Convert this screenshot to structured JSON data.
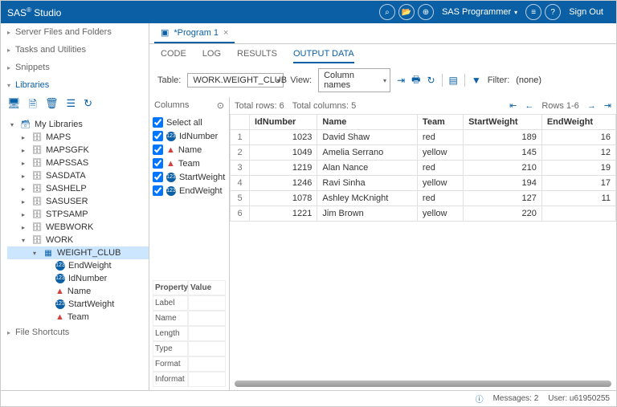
{
  "header": {
    "title_prefix": "SAS",
    "title_suffix": " Studio",
    "role": "SAS Programmer",
    "signout": "Sign Out"
  },
  "sidebar": {
    "sections": {
      "server_files": "Server Files and Folders",
      "tasks": "Tasks and Utilities",
      "snippets": "Snippets",
      "libraries": "Libraries",
      "shortcuts": "File Shortcuts"
    },
    "my_libraries": "My Libraries",
    "libs": [
      "MAPS",
      "MAPSGFK",
      "MAPSSAS",
      "SASDATA",
      "SASHELP",
      "SASUSER",
      "STPSAMP",
      "WEBWORK",
      "WORK"
    ],
    "table": "WEIGHT_CLUB",
    "table_cols": [
      {
        "name": "EndWeight",
        "type": "num"
      },
      {
        "name": "IdNumber",
        "type": "num"
      },
      {
        "name": "Name",
        "type": "char"
      },
      {
        "name": "StartWeight",
        "type": "num"
      },
      {
        "name": "Team",
        "type": "char"
      }
    ]
  },
  "tabs": {
    "program": "*Program 1",
    "sub": {
      "code": "CODE",
      "log": "LOG",
      "results": "RESULTS",
      "output": "OUTPUT DATA"
    }
  },
  "toolbar": {
    "table_label": "Table:",
    "table_value": "WORK.WEIGHT_CLUB",
    "view_label": "View:",
    "view_value": "Column names",
    "filter_label": "Filter:",
    "filter_value": "(none)"
  },
  "columns_panel": {
    "heading": "Columns",
    "select_all": "Select all",
    "cols": [
      {
        "name": "IdNumber",
        "type": "num"
      },
      {
        "name": "Name",
        "type": "char"
      },
      {
        "name": "Team",
        "type": "char"
      },
      {
        "name": "StartWeight",
        "type": "num"
      },
      {
        "name": "EndWeight",
        "type": "num"
      }
    ],
    "props": {
      "heading_k": "Property",
      "heading_v": "Value",
      "rows": [
        "Label",
        "Name",
        "Length",
        "Type",
        "Format",
        "Informat"
      ]
    }
  },
  "data": {
    "total_rows_label": "Total rows: 6",
    "total_cols_label": "Total columns: 5",
    "rows_range": "Rows 1-6",
    "headers": [
      "IdNumber",
      "Name",
      "Team",
      "StartWeight",
      "EndWeight"
    ],
    "rows": [
      {
        "n": "1",
        "IdNumber": "1023",
        "Name": "David Shaw",
        "Team": "red",
        "StartWeight": "189",
        "EndWeight": "16"
      },
      {
        "n": "2",
        "IdNumber": "1049",
        "Name": "Amelia Serrano",
        "Team": "yellow",
        "StartWeight": "145",
        "EndWeight": "12"
      },
      {
        "n": "3",
        "IdNumber": "1219",
        "Name": "Alan Nance",
        "Team": "red",
        "StartWeight": "210",
        "EndWeight": "19"
      },
      {
        "n": "4",
        "IdNumber": "1246",
        "Name": "Ravi Sinha",
        "Team": "yellow",
        "StartWeight": "194",
        "EndWeight": "17"
      },
      {
        "n": "5",
        "IdNumber": "1078",
        "Name": "Ashley McKnight",
        "Team": "red",
        "StartWeight": "127",
        "EndWeight": "11"
      },
      {
        "n": "6",
        "IdNumber": "1221",
        "Name": "Jim Brown",
        "Team": "yellow",
        "StartWeight": "220",
        "EndWeight": ""
      }
    ]
  },
  "footer": {
    "messages": "Messages: 2",
    "user": "User: u61950255"
  }
}
